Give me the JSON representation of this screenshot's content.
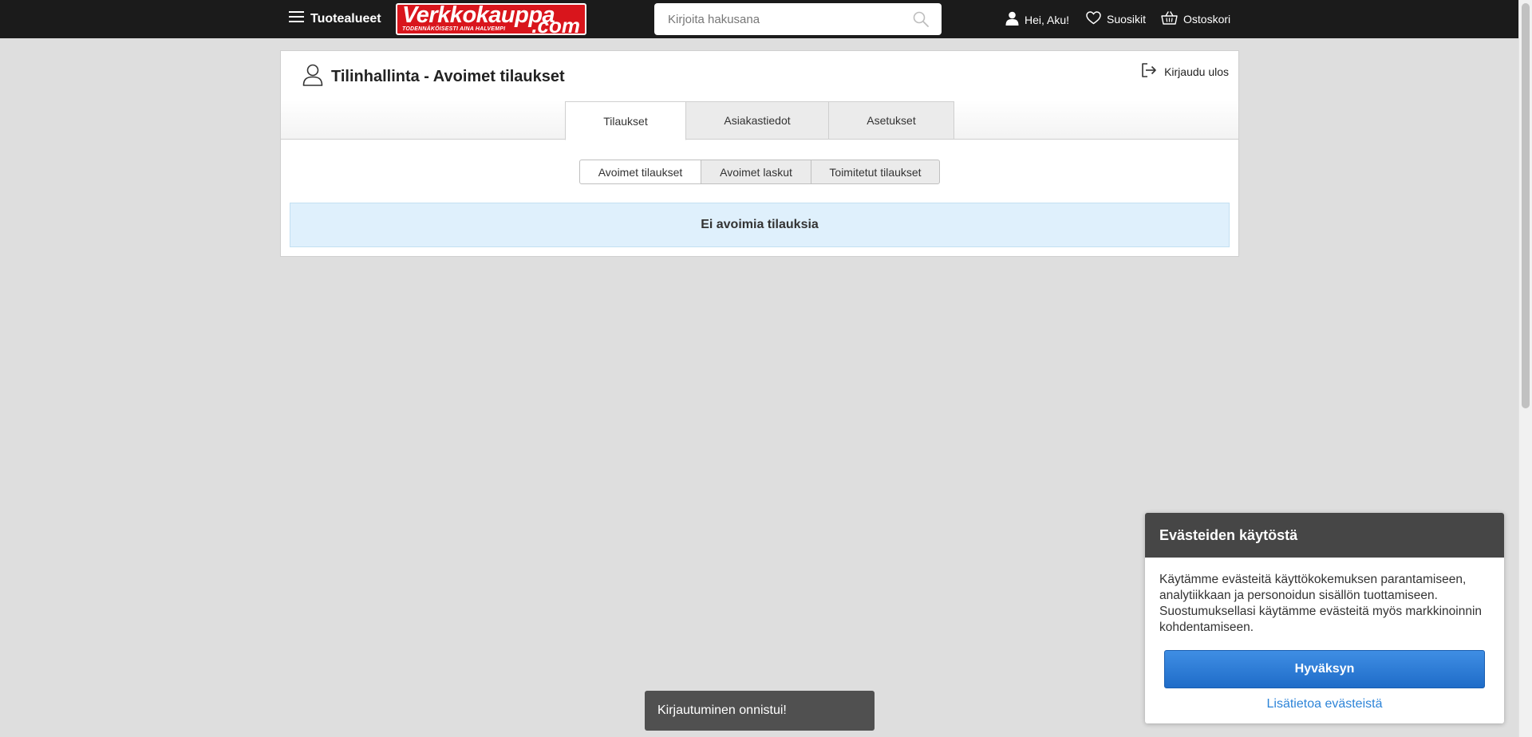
{
  "header": {
    "menu_label": "Tuotealueet",
    "logo": {
      "name": "Verkkokauppa",
      "suffix": ".com",
      "tagline": "TODENNÄKÖISESTI AINA HALVEMPI"
    },
    "search_placeholder": "Kirjoita hakusana",
    "user_label": "Hei, Aku!",
    "favorites_label": "Suosikit",
    "cart_label": "Ostoskori"
  },
  "page": {
    "title": "Tilinhallinta - Avoimet tilaukset",
    "logout_label": "Kirjaudu ulos",
    "tabs": [
      {
        "label": "Tilaukset",
        "active": true
      },
      {
        "label": "Asiakastiedot",
        "active": false
      },
      {
        "label": "Asetukset",
        "active": false
      }
    ],
    "subtabs": [
      {
        "label": "Avoimet tilaukset",
        "active": true
      },
      {
        "label": "Avoimet laskut",
        "active": false
      },
      {
        "label": "Toimitetut tilaukset",
        "active": false
      }
    ],
    "empty_message": "Ei avoimia tilauksia"
  },
  "toast": {
    "message": "Kirjautuminen onnistui!"
  },
  "cookie": {
    "title": "Evästeiden käytöstä",
    "text": "Käytämme evästeitä käyttökokemuksen parantamiseen, analytiikkaan ja personoidun sisällön tuottamiseen. Suostumuksellasi käytämme evästeitä myös markkinoinnin kohdentamiseen.",
    "accept_label": "Hyväksyn",
    "more_label": "Lisätietoa evästeistä"
  },
  "colors": {
    "topbar": "#1b1b1b",
    "brand_red": "#d9151c",
    "notice_bg": "#dff0fc",
    "accept_blue": "#2a7bd6",
    "link_blue": "#2d84d8"
  }
}
